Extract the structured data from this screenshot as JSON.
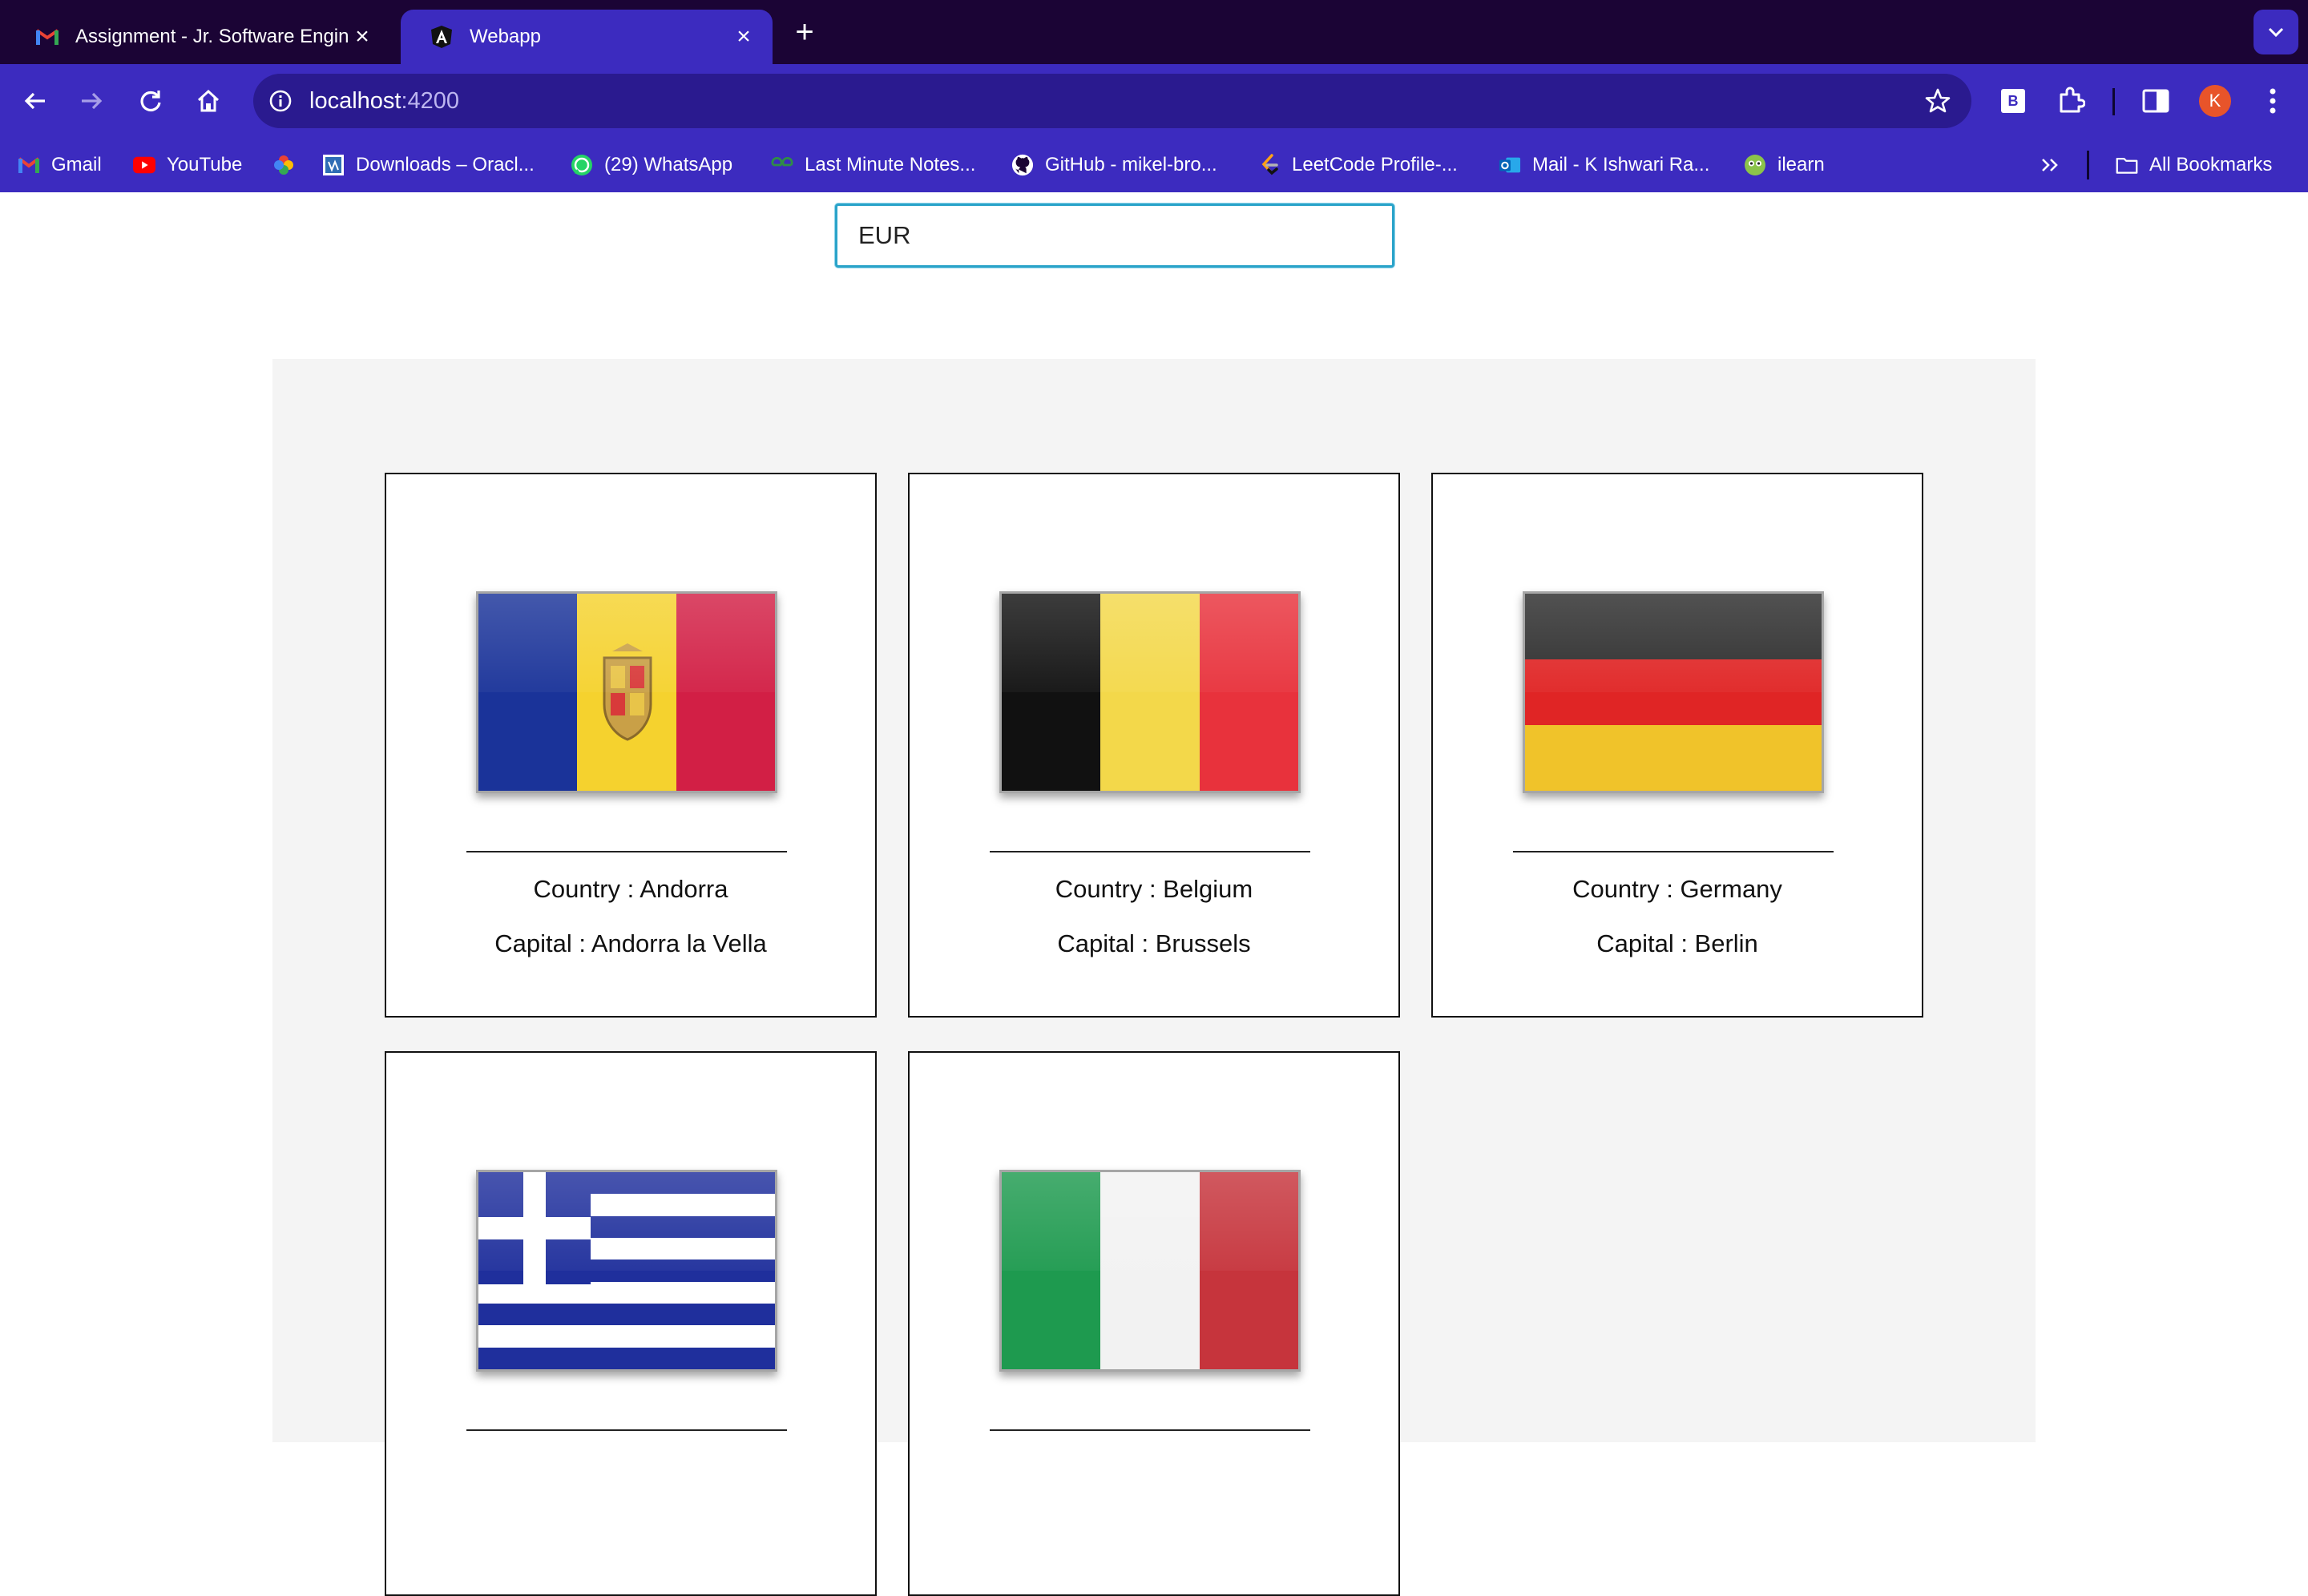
{
  "browser": {
    "tabs": [
      {
        "title": "Assignment - Jr. Software Engineer",
        "active": false,
        "icon": "gmail-icon"
      },
      {
        "title": "Webapp",
        "active": true,
        "icon": "angular-icon"
      }
    ],
    "url_host": "localhost",
    "url_port": ":4200",
    "profile_initial": "K",
    "extension_label": "B",
    "bookmarks": [
      {
        "label": "Gmail",
        "icon": "gmail-icon"
      },
      {
        "label": "YouTube",
        "icon": "youtube-icon"
      },
      {
        "label": "",
        "icon": "pinwheel-icon"
      },
      {
        "label": "Downloads – Oracl...",
        "icon": "oracle-icon"
      },
      {
        "label": "(29) WhatsApp",
        "icon": "whatsapp-icon"
      },
      {
        "label": "Last Minute Notes...",
        "icon": "gfg-icon"
      },
      {
        "label": "GitHub - mikel-bro...",
        "icon": "github-icon"
      },
      {
        "label": "LeetCode Profile-...",
        "icon": "leetcode-icon"
      },
      {
        "label": "Mail - K Ishwari Ra...",
        "icon": "outlook-icon"
      },
      {
        "label": "ilearn",
        "icon": "ilearn-icon"
      }
    ],
    "all_bookmarks_label": "All Bookmarks"
  },
  "search": {
    "value": "EUR"
  },
  "countries": [
    {
      "country": "Country : Andorra",
      "capital": "Capital : Andorra la Vella",
      "flag_colors": [
        "#1a3399",
        "#f5d22e",
        "#d21f45"
      ]
    },
    {
      "country": "Country : Belgium",
      "capital": "Capital : Brussels",
      "flag_colors": [
        "#111111",
        "#f3d84a",
        "#e8323c"
      ]
    },
    {
      "country": "Country : Germany",
      "capital": "Capital : Berlin",
      "flag_colors": [
        "#2b2b2b",
        "#e02525",
        "#f0c32a"
      ]
    },
    {
      "country": "",
      "capital": "",
      "flag_colors": [
        "#1f2f9c",
        "#ffffff"
      ]
    },
    {
      "country": "",
      "capital": "",
      "flag_colors": [
        "#1e9a4f",
        "#f2f2f2",
        "#c6343c"
      ]
    }
  ],
  "colors": {
    "tab_strip": "#1b0435",
    "toolbar": "#3c2bbf",
    "omnibox": "#2a1a8f",
    "search_border": "#2aa3c9",
    "panel_bg": "#f4f4f4"
  }
}
